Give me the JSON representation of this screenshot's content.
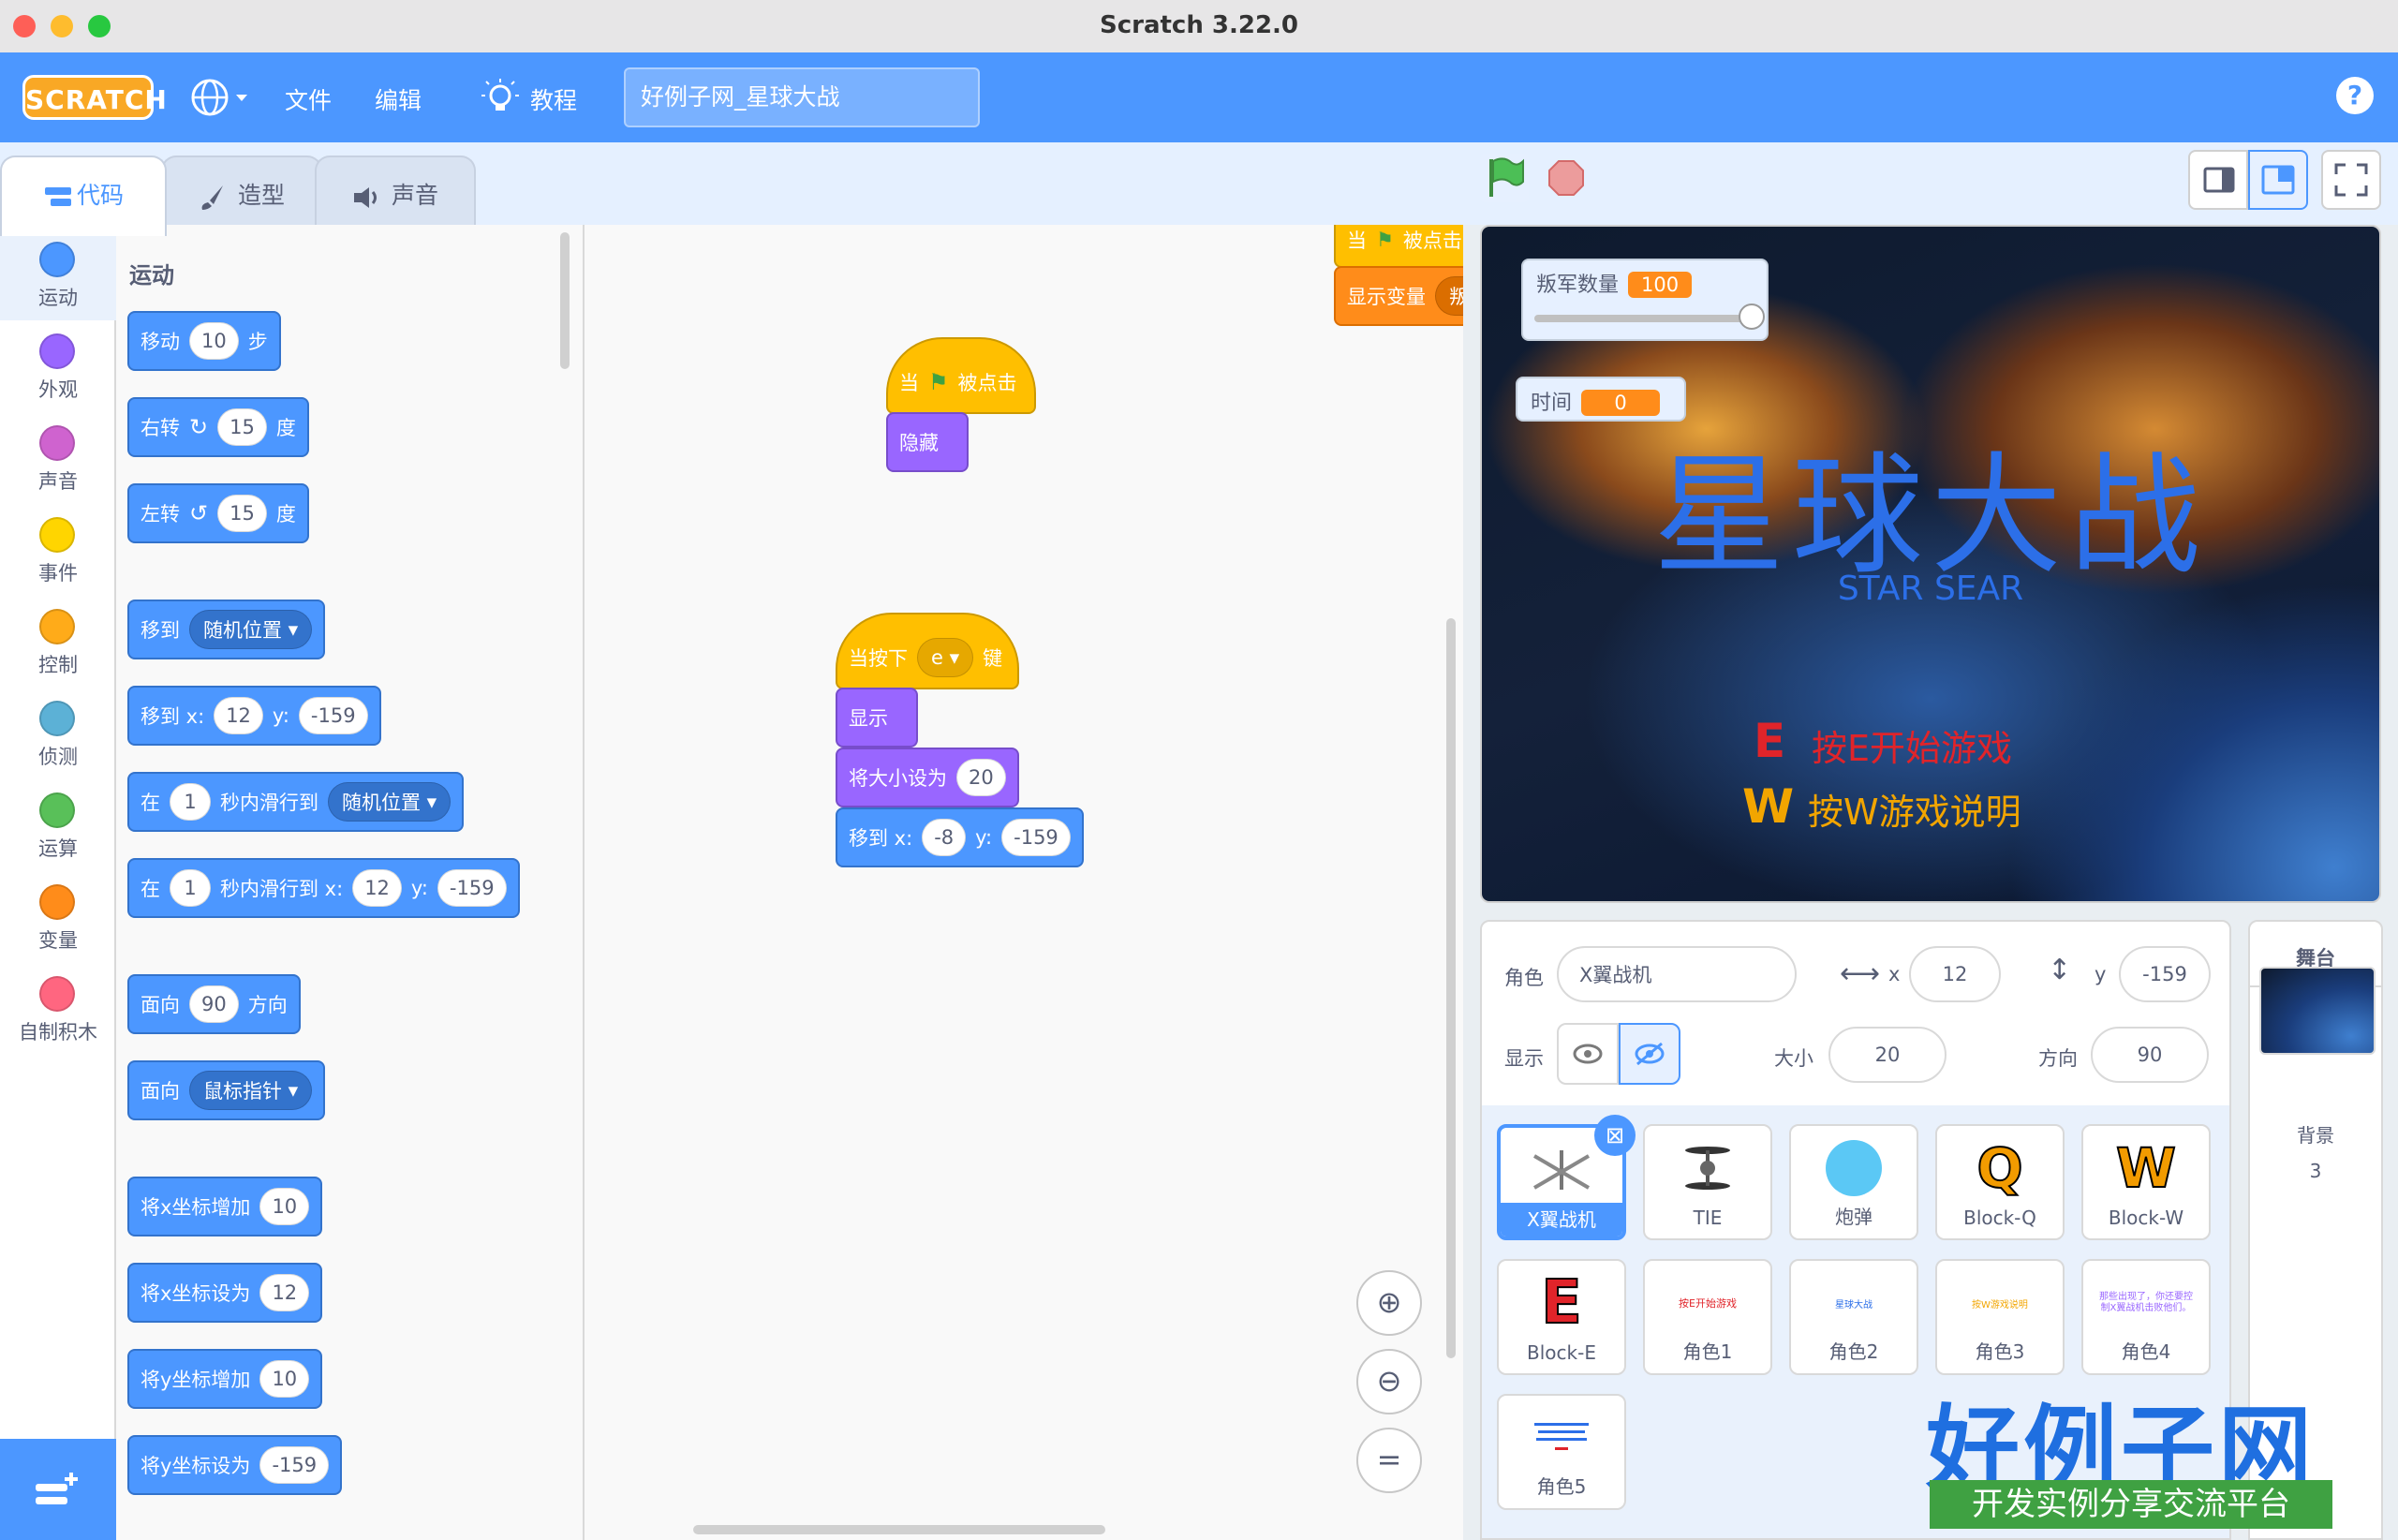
{
  "window": {
    "title": "Scratch 3.22.0"
  },
  "menubar": {
    "logo": "SCRATCH",
    "file": "文件",
    "edit": "编辑",
    "tutorials": "教程",
    "project_title": "好例子网_星球大战",
    "help": "?"
  },
  "tabs": {
    "code": "代码",
    "costumes": "造型",
    "sounds": "声音"
  },
  "categories": [
    {
      "label": "运动",
      "color": "#4c97ff"
    },
    {
      "label": "外观",
      "color": "#9966ff"
    },
    {
      "label": "声音",
      "color": "#cf63cf"
    },
    {
      "label": "事件",
      "color": "#ffd500"
    },
    {
      "label": "控制",
      "color": "#ffab19"
    },
    {
      "label": "侦测",
      "color": "#5cb1d6"
    },
    {
      "label": "运算",
      "color": "#59c059"
    },
    {
      "label": "变量",
      "color": "#ff8c1a"
    },
    {
      "label": "自制积木",
      "color": "#ff6680"
    }
  ],
  "palette": {
    "heading": "运动",
    "move": {
      "a": "移动",
      "v": "10",
      "b": "步"
    },
    "turn_right": {
      "a": "右转",
      "v": "15",
      "b": "度"
    },
    "turn_left": {
      "a": "左转",
      "v": "15",
      "b": "度"
    },
    "goto": {
      "a": "移到",
      "dd": "随机位置"
    },
    "goto_xy": {
      "a": "移到 x:",
      "x": "12",
      "y_label": "y:",
      "y": "-159"
    },
    "glide": {
      "a": "在",
      "v": "1",
      "b": "秒内滑行到",
      "dd": "随机位置"
    },
    "glide_xy": {
      "a": "在",
      "v": "1",
      "b": "秒内滑行到 x:",
      "x": "12",
      "y_label": "y:",
      "y": "-159"
    },
    "point_dir": {
      "a": "面向",
      "v": "90",
      "b": "方向"
    },
    "point_towards": {
      "a": "面向",
      "dd": "鼠标指针"
    },
    "change_x": {
      "a": "将x坐标增加",
      "v": "10"
    },
    "set_x": {
      "a": "将x坐标设为",
      "v": "12"
    },
    "change_y": {
      "a": "将y坐标增加",
      "v": "10"
    },
    "set_y": {
      "a": "将y坐标设为",
      "v": "-159"
    }
  },
  "script1": {
    "hat_a": "当",
    "hat_b": "被点击",
    "hide": "隐藏"
  },
  "script2": {
    "hat_a": "当按下",
    "key": "e",
    "hat_b": "键",
    "show": "显示",
    "size_a": "将大小设为",
    "size_v": "20",
    "goto_a": "移到 x:",
    "goto_x": "-8",
    "goto_y_label": "y:",
    "goto_y": "-159"
  },
  "script3": {
    "hat_a": "当",
    "hat_b": "被点击",
    "show_var": "显示变量",
    "var_trunc": "叛"
  },
  "monitors": {
    "rebels": {
      "label": "叛军数量",
      "value": "100",
      "slider": 1.0
    },
    "time": {
      "label": "时间",
      "value": "0"
    }
  },
  "stage_text": {
    "title": "星球大战",
    "subtitle": "STAR SEAR",
    "start_key": "E",
    "start": "按E开始游戏",
    "help_key": "W",
    "help": "按W游戏说明"
  },
  "sprite_info": {
    "sprite_label": "角色",
    "sprite_name": "X翼战机",
    "x_label": "x",
    "x": "12",
    "y_label": "y",
    "y": "-159",
    "show_label": "显示",
    "size_label": "大小",
    "size": "20",
    "dir_label": "方向",
    "dir": "90"
  },
  "sprites": [
    "X翼战机",
    "TIE",
    "炮弹",
    "Block-Q",
    "Block-W",
    "Block-E",
    "角色1",
    "角色2",
    "角色3",
    "角色4",
    "角色5"
  ],
  "sprite_thumbs": {
    "q": "Q",
    "w": "W",
    "e": "E",
    "s1": "按E开始游戏",
    "s2": "星球大战",
    "s3": "按W游戏说明",
    "s4": "那些出现了，你还要控制X翼战机击败他们。"
  },
  "stage_panel": {
    "label": "舞台",
    "backdrop_label": "背景",
    "backdrop_count": "3"
  },
  "watermark": {
    "big": "好例子网",
    "small": "开发实例分享交流平台"
  }
}
